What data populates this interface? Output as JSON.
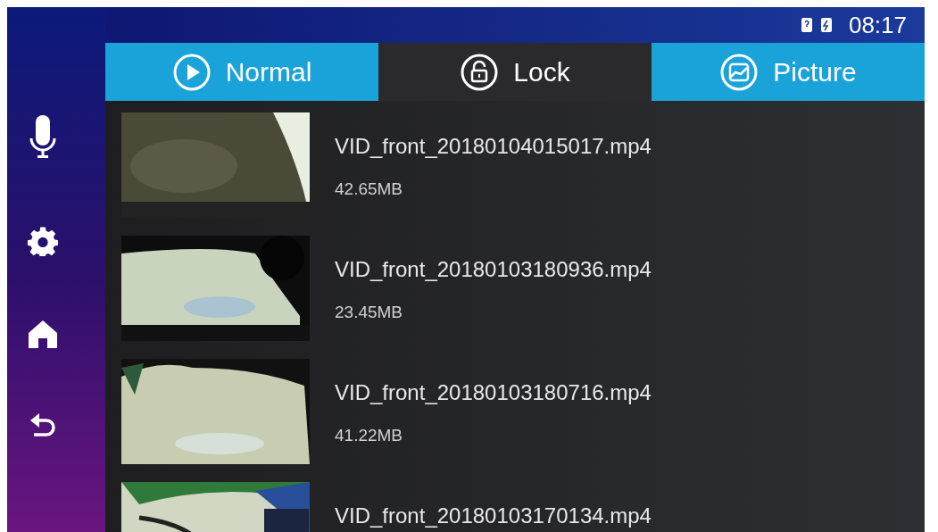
{
  "status_bar": {
    "time": "08:17"
  },
  "sidebar": {
    "items": [
      {
        "kind": "mic"
      },
      {
        "kind": "settings"
      },
      {
        "kind": "home"
      },
      {
        "kind": "back"
      }
    ]
  },
  "tabs": [
    {
      "label": "Normal",
      "kind": "play",
      "selected": false
    },
    {
      "label": "Lock",
      "kind": "lock",
      "selected": true
    },
    {
      "label": "Picture",
      "kind": "picture",
      "selected": false
    }
  ],
  "files": [
    {
      "name": "VID_front_20180104015017.mp4",
      "size": "42.65MB"
    },
    {
      "name": "VID_front_20180103180936.mp4",
      "size": "23.45MB"
    },
    {
      "name": "VID_front_20180103180716.mp4",
      "size": "41.22MB"
    },
    {
      "name": "VID_front_20180103170134.mp4"
    }
  ]
}
